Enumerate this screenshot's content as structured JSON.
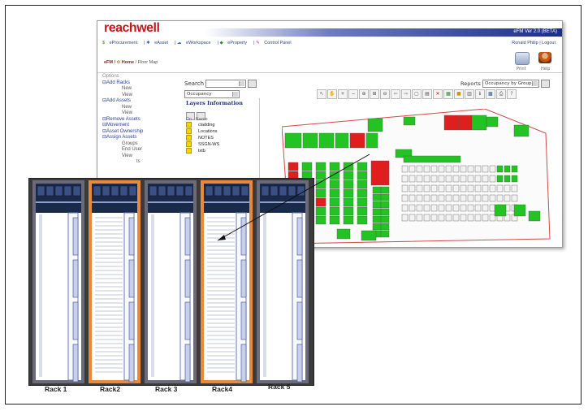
{
  "app": {
    "brand": "reachwell",
    "version": "eFM Ver 2.0 (BETA)",
    "nav": [
      "eProcurement",
      "eAsset",
      "eWorkspace",
      "eProperty",
      "Control Panel"
    ],
    "user": "Ronald Philip | Logout",
    "breadcrumb": {
      "module": "eFM /",
      "home": "Home",
      "page": "/ Floor Map"
    },
    "header_icons": [
      {
        "icon": "print-icon",
        "label": "Print"
      },
      {
        "icon": "help-icon",
        "label": "Help"
      }
    ]
  },
  "sidebar": {
    "options_label": "Options",
    "items": [
      {
        "label": "Add Racks",
        "type": "group"
      },
      {
        "label": "New",
        "type": "sub"
      },
      {
        "label": "View",
        "type": "sub"
      },
      {
        "label": "Add Assets",
        "type": "group"
      },
      {
        "label": "New",
        "type": "sub"
      },
      {
        "label": "View",
        "type": "sub"
      },
      {
        "label": "Remove Assets",
        "type": "group"
      },
      {
        "label": "Movement",
        "type": "group"
      },
      {
        "label": "Asset Ownership",
        "type": "group"
      },
      {
        "label": "Assign Assets",
        "type": "group"
      },
      {
        "label": "Groups",
        "type": "sub"
      },
      {
        "label": "End User",
        "type": "sub"
      },
      {
        "label": "View",
        "type": "sub"
      },
      {
        "label": "ts",
        "type": "sub"
      }
    ]
  },
  "search": {
    "label": "Search",
    "value": "",
    "view_value": "Occupancy"
  },
  "reports": {
    "label": "Reports",
    "value": "Occupancy by Group"
  },
  "layers": {
    "title": "Layers Information",
    "columns": [
      "On",
      "Name"
    ],
    "items": [
      "cladding",
      "Locations",
      "NOTES",
      "SSGN-WS",
      "txtb"
    ]
  },
  "racks": {
    "labels": [
      "Rack 1",
      "Rack2",
      "Rack 3",
      "Rack4",
      "Rack 5"
    ]
  }
}
